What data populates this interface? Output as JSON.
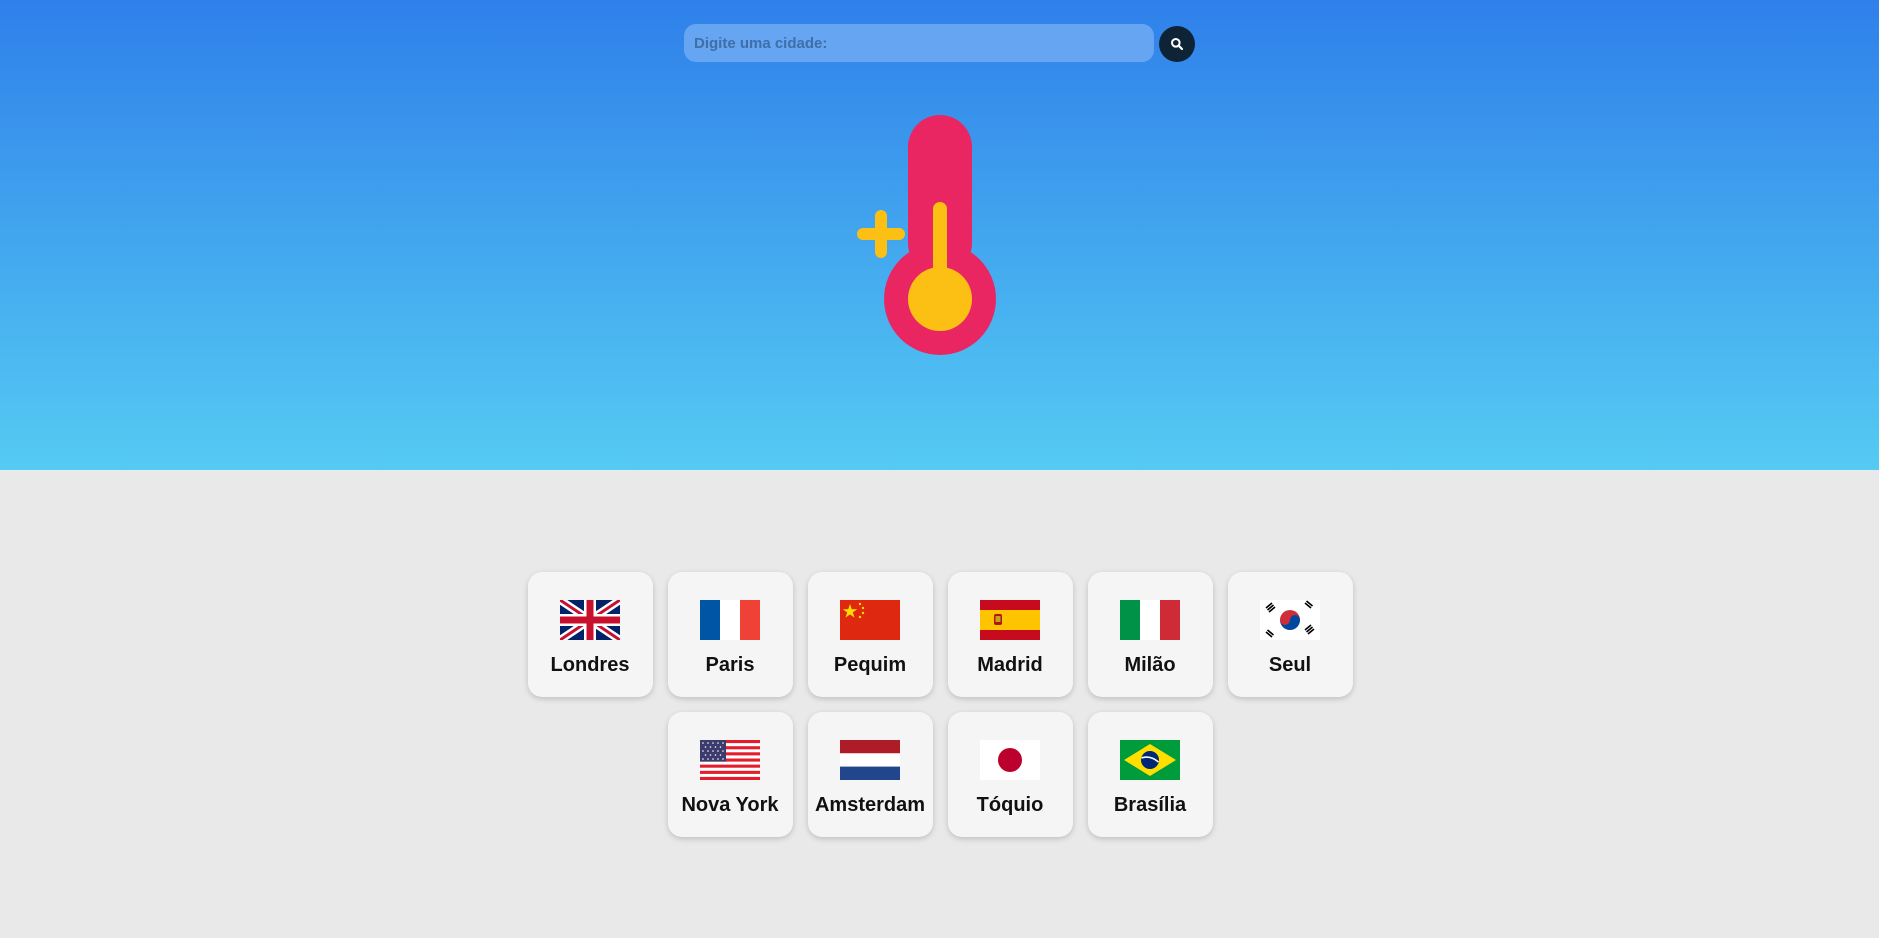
{
  "search": {
    "placeholder": "Digite uma cidade:",
    "value": "",
    "button_icon": "search-icon"
  },
  "hero": {
    "icon": "thermometer-plus-icon",
    "colors": {
      "gradient_top": "#2f80ea",
      "gradient_bottom": "#55cbf3",
      "thermometer_body": "#e92662",
      "thermometer_accent": "#fcc015"
    }
  },
  "cities": [
    {
      "label": "Londres",
      "flag": "uk-flag-icon"
    },
    {
      "label": "Paris",
      "flag": "france-flag-icon"
    },
    {
      "label": "Pequim",
      "flag": "china-flag-icon"
    },
    {
      "label": "Madrid",
      "flag": "spain-flag-icon"
    },
    {
      "label": "Milão",
      "flag": "italy-flag-icon"
    },
    {
      "label": "Seul",
      "flag": "south-korea-flag-icon"
    },
    {
      "label": "Nova York",
      "flag": "usa-flag-icon"
    },
    {
      "label": "Amsterdam",
      "flag": "netherlands-flag-icon"
    },
    {
      "label": "Tóquio",
      "flag": "japan-flag-icon"
    },
    {
      "label": "Brasília",
      "flag": "brazil-flag-icon"
    }
  ]
}
